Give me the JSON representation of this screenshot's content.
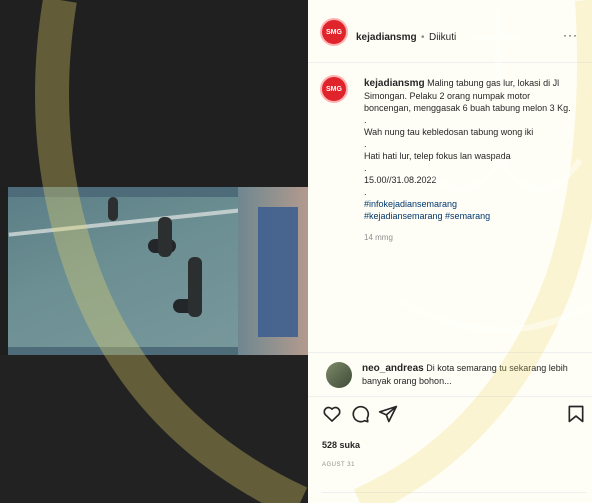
{
  "post": {
    "username": "kejadiansmg",
    "separator": "•",
    "follow_label": "Diikuti",
    "more_label": "···",
    "avatar_text": "SMG"
  },
  "caption": {
    "username": "kejadiansmg",
    "text": "Maling tabung gas lur, lokasi di Jl Simongan. Pelaku 2 orang numpak motor boncengan, menggasak 6 buah tabung melon 3 Kg.",
    "dot1": ".",
    "line2": "Wah nung tau kebledosan tabung wong iki",
    "dot2": ".",
    "line3": "Hati hati lur, telep fokus lan waspada",
    "dot3": ".",
    "time_stamp": "15.00//31.08.2022",
    "dot4": ".",
    "hashtags_line1": "#infokejadiansemarang",
    "hashtags_line2": "#kejadiansemarang #semarang",
    "posted_ago": "14 mmg"
  },
  "comment": {
    "username": "neo_andreas",
    "text": "Di kota semarang tu sekarang lebih banyak orang bohon..."
  },
  "actions": {
    "like_icon": "heart-icon",
    "comment_icon": "comment-icon",
    "share_icon": "send-icon",
    "save_icon": "bookmark-icon"
  },
  "likes": "528 suka",
  "date": "AGUST 31"
}
